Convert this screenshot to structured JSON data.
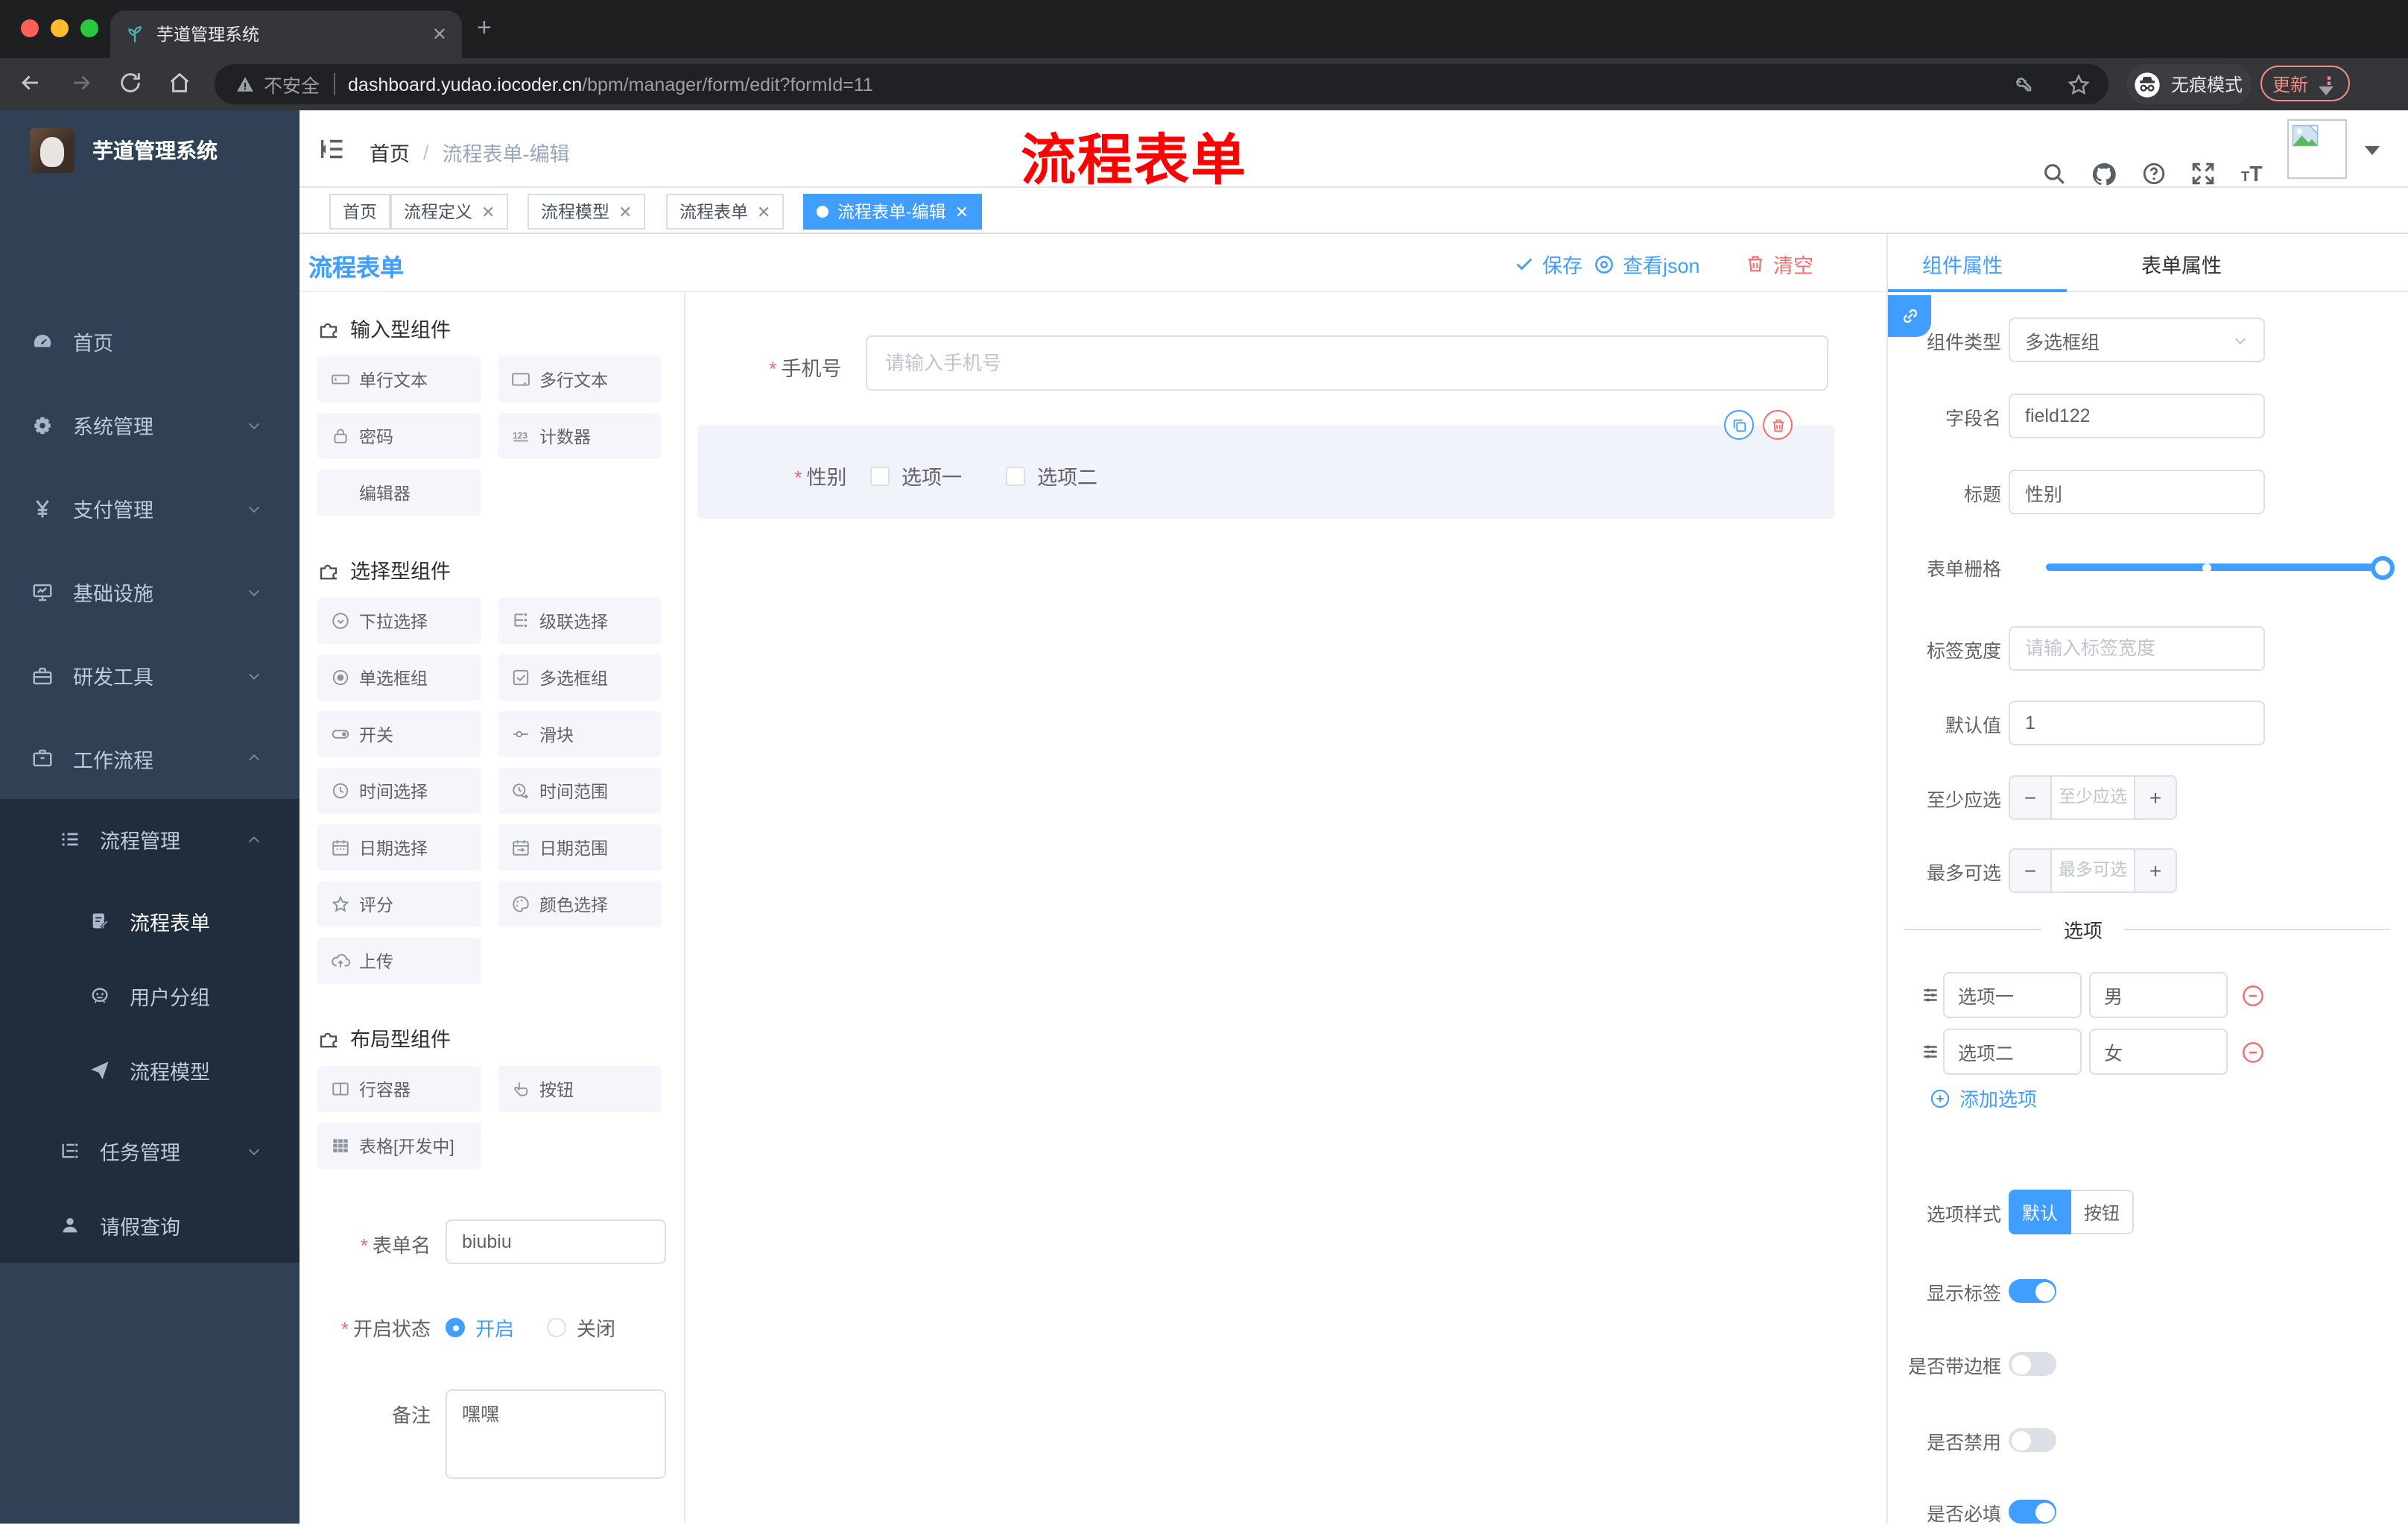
{
  "browser": {
    "tab_title": "芋道管理系统",
    "security": "不安全",
    "url_host": "dashboard.yudao.iocoder.cn",
    "url_path": "/bpm/manager/form/edit?formId=11",
    "incognito": "无痕模式",
    "update": "更新"
  },
  "sidebar": {
    "title": "芋道管理系统",
    "items": [
      {
        "label": "首页"
      },
      {
        "label": "系统管理"
      },
      {
        "label": "支付管理"
      },
      {
        "label": "基础设施"
      },
      {
        "label": "研发工具"
      },
      {
        "label": "工作流程"
      }
    ],
    "workflow": {
      "group": "流程管理",
      "children": [
        {
          "label": "流程表单"
        },
        {
          "label": "用户分组"
        },
        {
          "label": "流程模型"
        }
      ],
      "siblings": [
        {
          "label": "任务管理"
        },
        {
          "label": "请假查询"
        }
      ]
    }
  },
  "navbar": {
    "breadcrumb_home": "首页",
    "breadcrumb_current": "流程表单-编辑",
    "annotation": "流程表单"
  },
  "tags": [
    {
      "label": "首页"
    },
    {
      "label": "流程定义"
    },
    {
      "label": "流程模型"
    },
    {
      "label": "流程表单"
    },
    {
      "label": "流程表单-编辑"
    }
  ],
  "toolbar": {
    "title": "流程表单",
    "save": "保存",
    "view_json": "查看json",
    "clear": "清空"
  },
  "components": {
    "section_input": "输入型组件",
    "input_items": [
      "单行文本",
      "多行文本",
      "密码",
      "计数器",
      "编辑器"
    ],
    "section_select": "选择型组件",
    "select_items": [
      "下拉选择",
      "级联选择",
      "单选框组",
      "多选框组",
      "开关",
      "滑块",
      "时间选择",
      "时间范围",
      "日期选择",
      "日期范围",
      "评分",
      "颜色选择",
      "上传"
    ],
    "section_layout": "布局型组件",
    "layout_items": [
      "行容器",
      "按钮",
      "表格[开发中]"
    ]
  },
  "form_meta": {
    "name_label": "表单名",
    "name_value": "biubiu",
    "status_label": "开启状态",
    "status_on": "开启",
    "status_off": "关闭",
    "remark_label": "备注",
    "remark_value": "嘿嘿"
  },
  "canvas": {
    "phone_label": "手机号",
    "phone_placeholder": "请输入手机号",
    "gender_label": "性别",
    "gender_opt1": "选项一",
    "gender_opt2": "选项二"
  },
  "props": {
    "tab_component": "组件属性",
    "tab_form": "表单属性",
    "type_label": "组件类型",
    "type_value": "多选框组",
    "field_label": "字段名",
    "field_value": "field122",
    "title_label": "标题",
    "title_value": "性别",
    "grid_label": "表单栅格",
    "labelw_label": "标签宽度",
    "labelw_placeholder": "请输入标签宽度",
    "default_label": "默认值",
    "default_value": "1",
    "min_label": "至少应选",
    "min_placeholder": "至少应选",
    "max_label": "最多可选",
    "max_placeholder": "最多可选",
    "divider": "选项",
    "options": [
      {
        "label": "选项一",
        "value": "男"
      },
      {
        "label": "选项二",
        "value": "女"
      }
    ],
    "add_option": "添加选项",
    "style_label": "选项样式",
    "style_default": "默认",
    "style_button": "按钮",
    "toggle_show": "显示标签",
    "toggle_border": "是否带边框",
    "toggle_disabled": "是否禁用",
    "toggle_required": "是否必填"
  }
}
